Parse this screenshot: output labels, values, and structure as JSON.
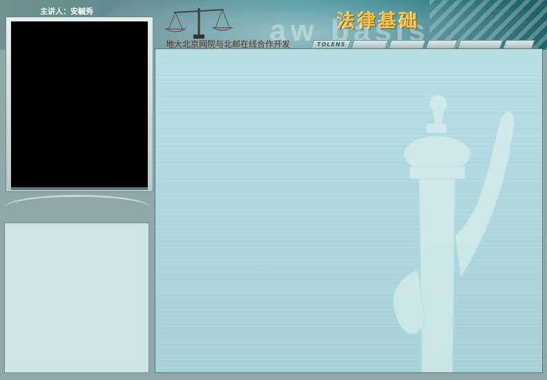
{
  "header": {
    "lecturer": "主讲人：安毓秀",
    "title": "法律基础",
    "watermark": "aw basis",
    "subtitle": "地大北京网院与北邮在线合作开发",
    "tab_label": "TOLENS"
  },
  "colors": {
    "banner_teal": "#3f8f98",
    "title_gold": "#f3c447",
    "content_bg": "#a6d2d8",
    "video_bg": "#000000",
    "notes_bg": "#cde3e6"
  },
  "icons": [
    "scales-of-justice-icon",
    "monument-column-icon"
  ]
}
